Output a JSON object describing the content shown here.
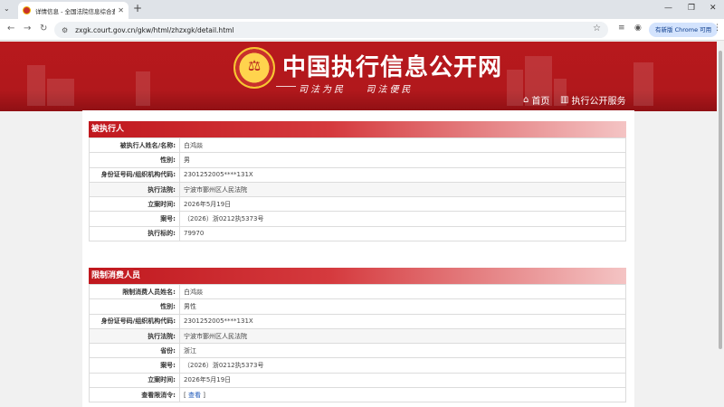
{
  "browser": {
    "tab_title": "详情信息 - 全国法院信息综合查",
    "url": "zxgk.court.gov.cn/gkw/html/zhzxgk/detail.html",
    "update_button": "有新版 Chrome 可用"
  },
  "banner": {
    "site_title": "中国执行信息公开网",
    "slogan_left": "司法为民",
    "slogan_right": "司法便民",
    "nav": [
      "首页",
      "执行公开服务"
    ]
  },
  "sections": [
    {
      "title": "被执行人",
      "rows": [
        {
          "label": "被执行人姓名/名称:",
          "value": "白鸿燚"
        },
        {
          "label": "性别:",
          "value": "男"
        },
        {
          "label": "身份证号码/组织机构代码:",
          "value": "2301252005****131X"
        },
        {
          "label": "执行法院:",
          "value": "宁波市鄞州区人民法院"
        },
        {
          "label": "立案时间:",
          "value": "2026年5月19日"
        },
        {
          "label": "案号:",
          "value": "（2026）浙0212执5373号"
        },
        {
          "label": "执行标的:",
          "value": "79970"
        }
      ]
    },
    {
      "title": "限制消费人员",
      "rows": [
        {
          "label": "限制消费人员姓名:",
          "value": "白鸿燚"
        },
        {
          "label": "性别:",
          "value": "男性"
        },
        {
          "label": "身份证号码/组织机构代码:",
          "value": "2301252005****131X"
        },
        {
          "label": "执行法院:",
          "value": "宁波市鄞州区人民法院"
        },
        {
          "label": "省份:",
          "value": "浙江"
        },
        {
          "label": "案号:",
          "value": "（2026）浙0212执5373号"
        },
        {
          "label": "立案时间:",
          "value": "2026年5月19日"
        },
        {
          "label": "查看限消令:",
          "value": "查看"
        }
      ]
    }
  ]
}
